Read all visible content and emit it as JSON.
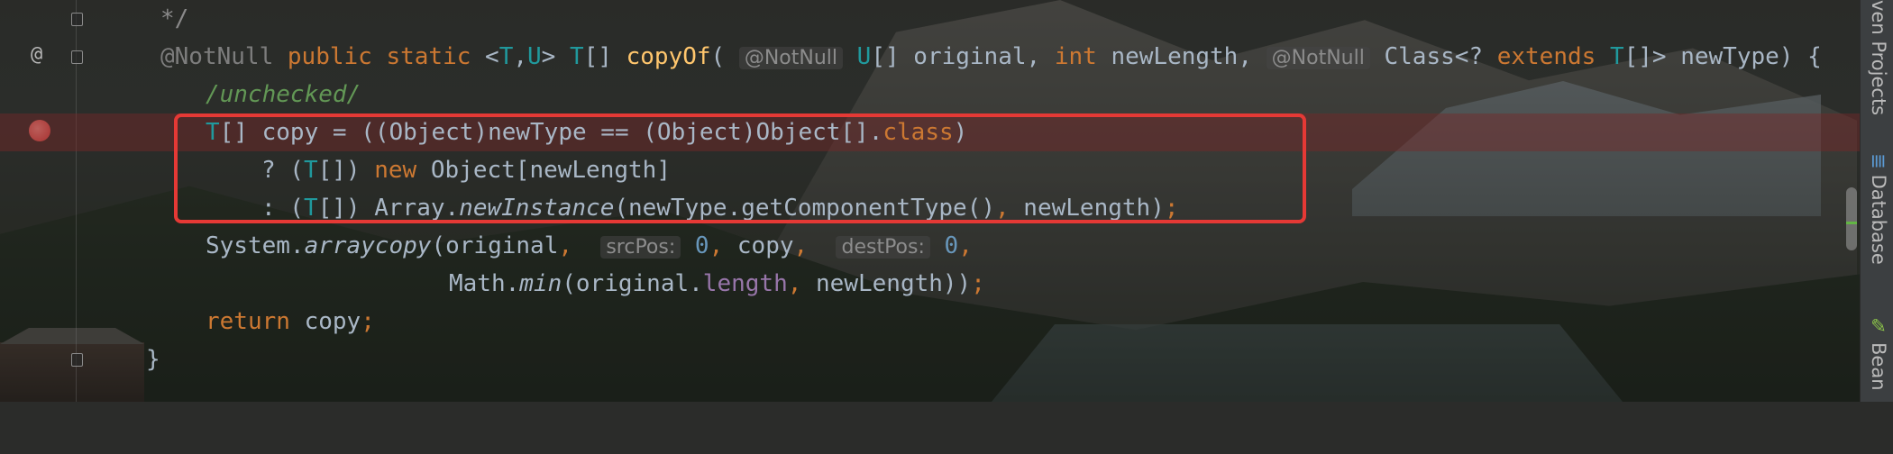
{
  "editor": {
    "lines": {
      "l1": {
        "comment_end": "*/"
      },
      "l2": {
        "ann1": "@NotNull",
        "kw_public": "public",
        "kw_static": "static",
        "open_angle": "<",
        "tp_T": "T",
        "comma": ",",
        "tp_U": "U",
        "close_angle": ">",
        "ret_T": "T",
        "ret_arr": "[]",
        "method_name": "copyOf",
        "paren_open": "(",
        "ann2": "@NotNull",
        "param_U": "U",
        "param1_rest": "[] original,",
        "kw_int": "int",
        "param2_rest": "newLength,",
        "ann3": "@NotNull",
        "class_part": "Class<?",
        "kw_extends": "extends",
        "ext_T": "T",
        "tail": "[]> newType) {"
      },
      "l3": {
        "text": "/unchecked/"
      },
      "l4": {
        "T": "T",
        "rest1": "[] copy = ((Object)newType == (Object)Object[].",
        "kw_class": "class",
        "rest2": ")"
      },
      "l5": {
        "pre": "? (",
        "T": "T",
        "mid": "[]) ",
        "kw_new": "new",
        "post": " Object[newLength]"
      },
      "l6": {
        "pre": ": (",
        "T": "T",
        "mid": "[]) Array.",
        "method": "newInstance",
        "args": "(newType.getComponentType()",
        "comma": ",",
        "post": " newLength)",
        "semi": ";"
      },
      "l7": {
        "pre": "System.",
        "method": "arraycopy",
        "arg1": "(original",
        "comma1": ",",
        "hint1": "srcPos:",
        "num1": "0",
        "comma2": ",",
        "arg3": " copy",
        "comma3": ",",
        "hint2": "destPos:",
        "num2": "0",
        "comma4": ","
      },
      "l8": {
        "pre": "Math.",
        "method": "min",
        "arg": "(original.",
        "field": "length",
        "comma": ",",
        "post": " newLength))",
        "semi": ";"
      },
      "l9": {
        "kw_return": "return",
        "rest": " copy",
        "semi": ";"
      },
      "l10": {
        "brace": "}"
      }
    },
    "gutter_markers": {
      "override": "@"
    }
  },
  "tool_windows": {
    "maven": "ven Projects",
    "database": "Database",
    "bean": "Bean"
  },
  "colors": {
    "keyword": "#cc7832",
    "method_decl": "#ffc66d",
    "type_param": "#507874",
    "number": "#6897bb",
    "field": "#9876aa",
    "breakpoint": "#d9534f",
    "highlight_border": "#e53935"
  },
  "icons": [
    "breakpoint-icon",
    "fold-icon",
    "override-marker-icon",
    "database-icon",
    "bean-icon"
  ]
}
